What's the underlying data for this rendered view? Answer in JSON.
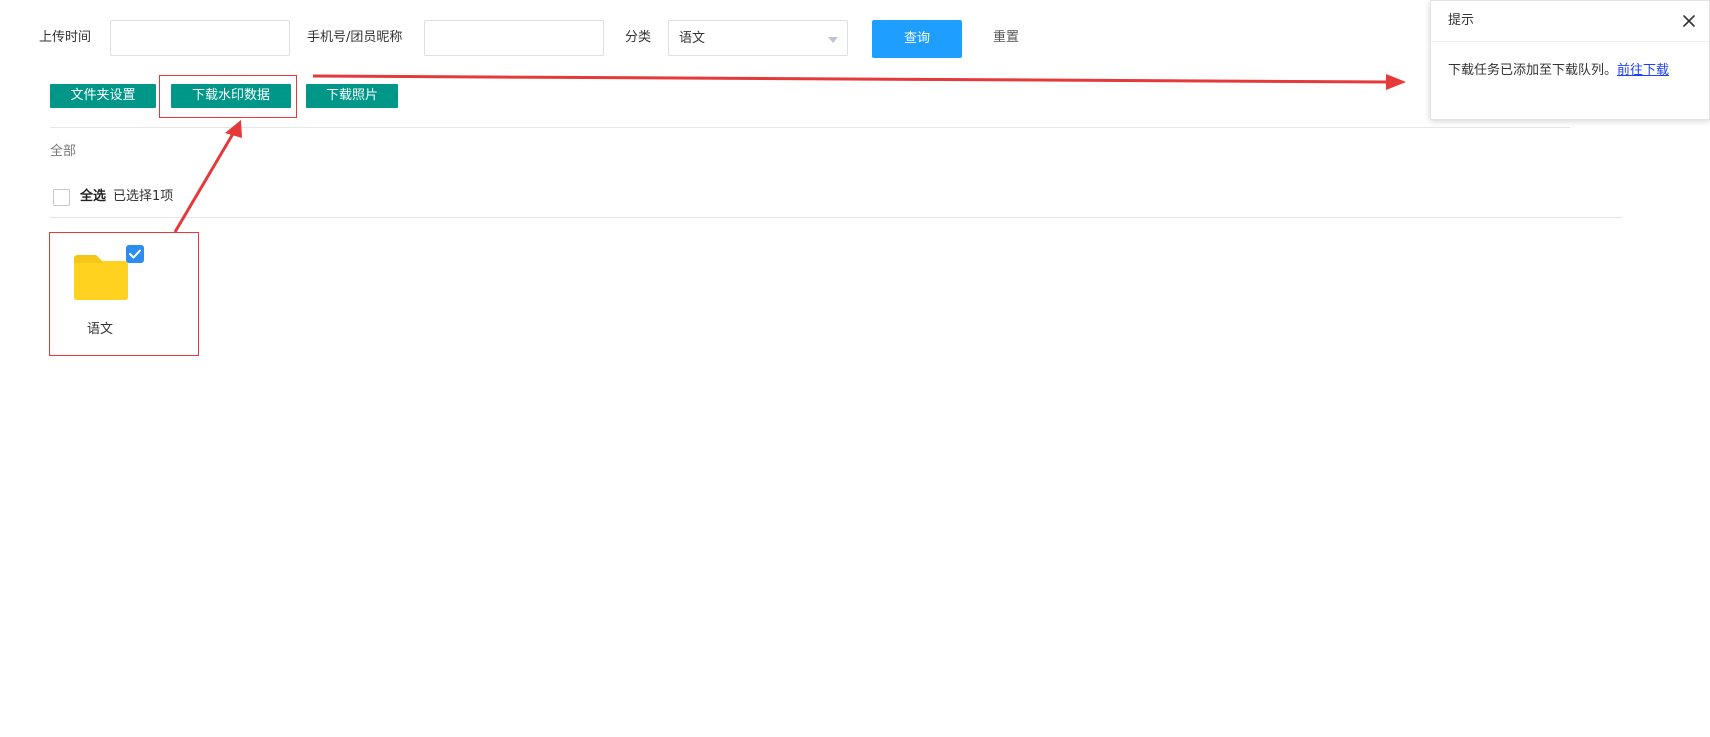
{
  "filters": {
    "upload_time_label": "上传时间",
    "upload_time_value": "",
    "phone_nickname_label": "手机号/团员昵称",
    "phone_nickname_value": "",
    "category_label": "分类",
    "category_value": "语文",
    "query_button": "查询",
    "reset_button": "重置"
  },
  "toolbar": {
    "folder_settings": "文件夹设置",
    "download_watermark": "下载水印数据",
    "download_photos": "下载照片"
  },
  "breadcrumb": "全部",
  "selection": {
    "select_all": "全选",
    "selected_count": "已选择1项"
  },
  "folders": [
    {
      "name": "语文",
      "checked": true
    }
  ],
  "popup": {
    "title": "提示",
    "message": "下载任务已添加至下载队列。",
    "link": "前往下载"
  },
  "colors": {
    "primary": "#1e9fff",
    "teal": "#009688",
    "folder": "#ffd21f",
    "annotation": "#e5393a",
    "checkbox": "#2d8cf0"
  }
}
